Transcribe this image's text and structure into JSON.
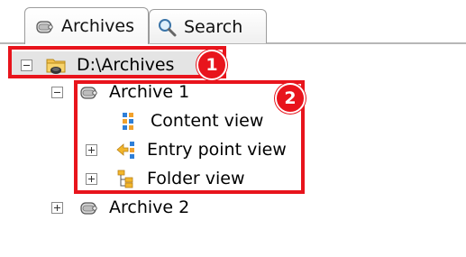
{
  "tabs": [
    {
      "label": "Archives",
      "icon": "archive-icon",
      "active": true
    },
    {
      "label": "Search",
      "icon": "magnifier-icon",
      "active": false
    }
  ],
  "tree": {
    "root": {
      "label": "D:\\Archives",
      "icon": "folder-drive-icon",
      "expanded": true
    },
    "archive1": {
      "label": "Archive 1",
      "icon": "archive-icon",
      "expanded": true
    },
    "content_view": {
      "label": "Content view",
      "icon": "grid-icon"
    },
    "entry_point_view": {
      "label": "Entry point view",
      "icon": "entry-point-icon",
      "expanded": false
    },
    "folder_view": {
      "label": "Folder view",
      "icon": "folder-tree-icon",
      "expanded": false
    },
    "archive2": {
      "label": "Archive 2",
      "icon": "archive-icon",
      "expanded": false
    }
  },
  "callouts": [
    {
      "number": "1"
    },
    {
      "number": "2"
    }
  ],
  "colors": {
    "callout_red": "#e8141c",
    "selection_gray": "#e4e4e4",
    "tab_border": "#9c9c9c"
  }
}
